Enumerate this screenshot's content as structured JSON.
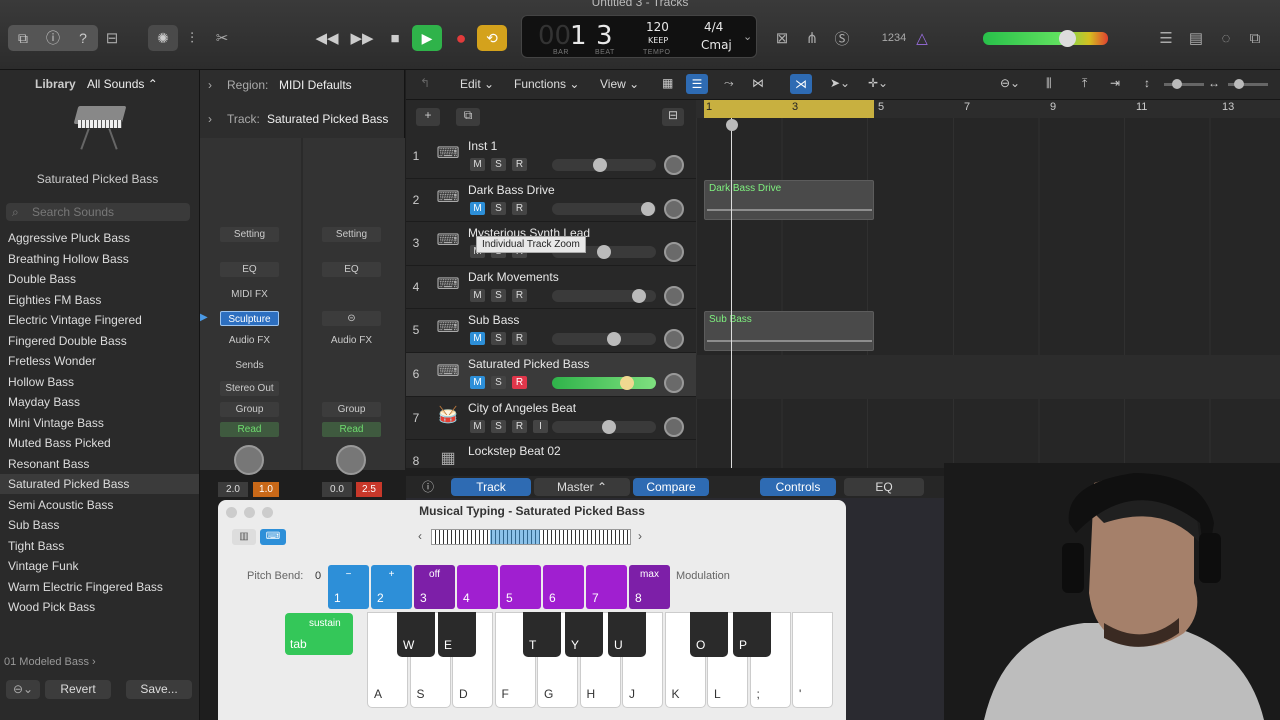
{
  "window": {
    "title": "Untitled 3 - Tracks"
  },
  "lcd": {
    "bar": "1",
    "beat": "3",
    "bar_label": "BAR",
    "beat_label": "BEAT",
    "tempo": "120",
    "tempo_mode": "KEEP",
    "tempo_label": "TEMPO",
    "signature": "4/4",
    "key": "Cmaj"
  },
  "count_in": "1234",
  "library": {
    "title": "Library",
    "sounds_filter": "All Sounds ⌃",
    "patch_name": "Saturated Picked Bass",
    "search_placeholder": "Search Sounds",
    "items": [
      "Aggressive Pluck Bass",
      "Breathing Hollow Bass",
      "Double Bass",
      "Eighties FM Bass",
      "Electric Vintage Fingered",
      "Fingered Double Bass",
      "Fretless Wonder",
      "Hollow Bass",
      "Mayday Bass",
      "Mini Vintage Bass",
      "Muted Bass Picked",
      "Resonant Bass",
      "Saturated Picked Bass",
      "Semi Acoustic Bass",
      "Sub Bass",
      "Tight Bass",
      "Vintage Funk",
      "Warm Electric Fingered Bass",
      "Wood Pick Bass"
    ],
    "breadcrumb": "01 Modeled Bass",
    "revert": "Revert",
    "save": "Save..."
  },
  "inspector": {
    "region_label": "Region:",
    "region_value": "MIDI Defaults",
    "track_label": "Track:",
    "track_value": "Saturated Picked Bass",
    "left": {
      "setting": "Setting",
      "eq": "EQ",
      "midi_fx": "MIDI FX",
      "instrument": "Sculpture",
      "audio_fx": "Audio FX",
      "sends": "Sends",
      "output": "Stereo Out",
      "group": "Group",
      "automation": "Read",
      "pan_val": "2.0",
      "vol_val": "1.0"
    },
    "right": {
      "setting": "Setting",
      "eq": "EQ",
      "audio_fx": "Audio FX",
      "group": "Group",
      "automation": "Read",
      "pan_val": "0.0",
      "vol_val": "2.5"
    }
  },
  "toolbar": {
    "edit": "Edit",
    "functions": "Functions",
    "view": "View"
  },
  "ruler": [
    "1",
    "3",
    "5",
    "7",
    "9",
    "11",
    "13"
  ],
  "tracks": [
    {
      "num": "1",
      "name": "Inst 1",
      "m": "M",
      "s": "S",
      "r": "R"
    },
    {
      "num": "2",
      "name": "Dark Bass Drive",
      "m": "M",
      "s": "S",
      "r": "R"
    },
    {
      "num": "3",
      "name": "Mysterious Synth Lead",
      "m": "M",
      "s": "S",
      "r": "R"
    },
    {
      "num": "4",
      "name": "Dark Movements",
      "m": "M",
      "s": "S",
      "r": "R"
    },
    {
      "num": "5",
      "name": "Sub Bass",
      "m": "M",
      "s": "S",
      "r": "R"
    },
    {
      "num": "6",
      "name": "Saturated Picked Bass",
      "m": "M",
      "s": "S",
      "r": "R"
    },
    {
      "num": "7",
      "name": "City of Angeles Beat",
      "m": "M",
      "s": "S",
      "r": "R",
      "i": "I"
    },
    {
      "num": "8",
      "name": "Lockstep Beat 02"
    }
  ],
  "tooltip": "Individual Track Zoom",
  "regions": {
    "r1": "Dark Bass Drive",
    "r2": "Sub Bass"
  },
  "bottom": {
    "track": "Track",
    "master": "Master",
    "compare": "Compare",
    "controls": "Controls",
    "eq": "EQ"
  },
  "musical_typing": {
    "title": "Musical Typing - Saturated Picked Bass",
    "pitch_bend_label": "Pitch Bend:",
    "pitch_bend_value": "0",
    "modulation_label": "Modulation",
    "pads": [
      {
        "top": "−",
        "num": "1"
      },
      {
        "top": "+",
        "num": "2"
      },
      {
        "top": "off",
        "num": "3"
      },
      {
        "top": "",
        "num": "4"
      },
      {
        "top": "",
        "num": "5"
      },
      {
        "top": "",
        "num": "6"
      },
      {
        "top": "",
        "num": "7"
      },
      {
        "top": "max",
        "num": "8"
      }
    ],
    "sustain": "sustain",
    "tab": "tab",
    "white_keys": [
      "A",
      "S",
      "D",
      "F",
      "G",
      "H",
      "J",
      "K",
      "L",
      ";",
      "'"
    ],
    "black_keys": [
      "W",
      "E",
      "T",
      "Y",
      "U",
      "O",
      "P"
    ]
  }
}
